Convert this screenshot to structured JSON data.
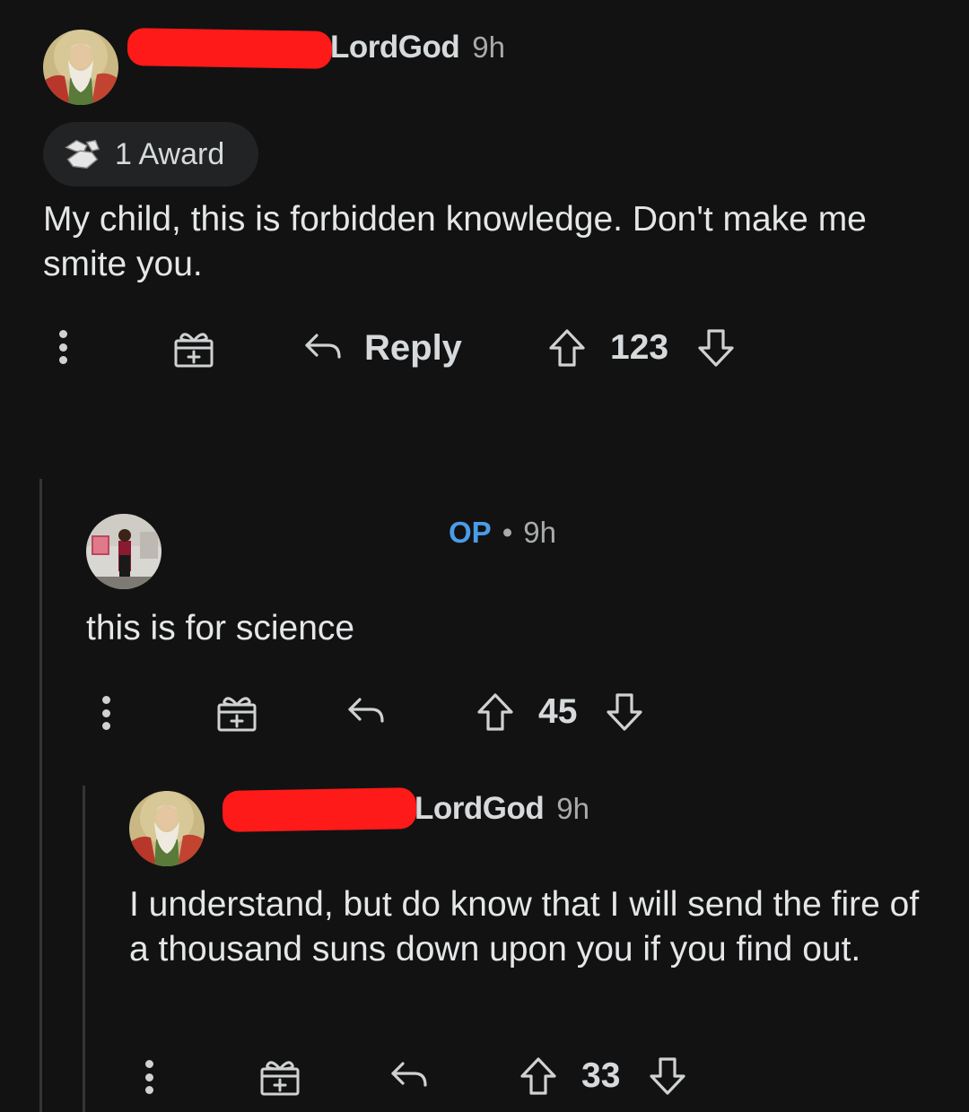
{
  "comments": [
    {
      "username": "LordGod",
      "time": "9h",
      "award_label": "1 Award",
      "body": "My child, this is forbidden knowledge. Don't make me smite you.",
      "reply_label": "Reply",
      "votes": "123",
      "avatar_icon": "old-man-avatar"
    },
    {
      "op_label": "OP",
      "separator": "•",
      "time": "9h",
      "body": "this is for science",
      "votes": "45",
      "avatar_icon": "person-photo-avatar"
    },
    {
      "username": "LordGod",
      "time": "9h",
      "body": "I understand, but do know that I will send the fire of a thousand suns down upon you if you find out.",
      "votes": "33",
      "avatar_icon": "old-man-avatar"
    }
  ],
  "colors": {
    "background": "#121212",
    "text": "#d7dadc",
    "op_blue": "#4a9ce8",
    "redaction": "#ff1a1a"
  }
}
